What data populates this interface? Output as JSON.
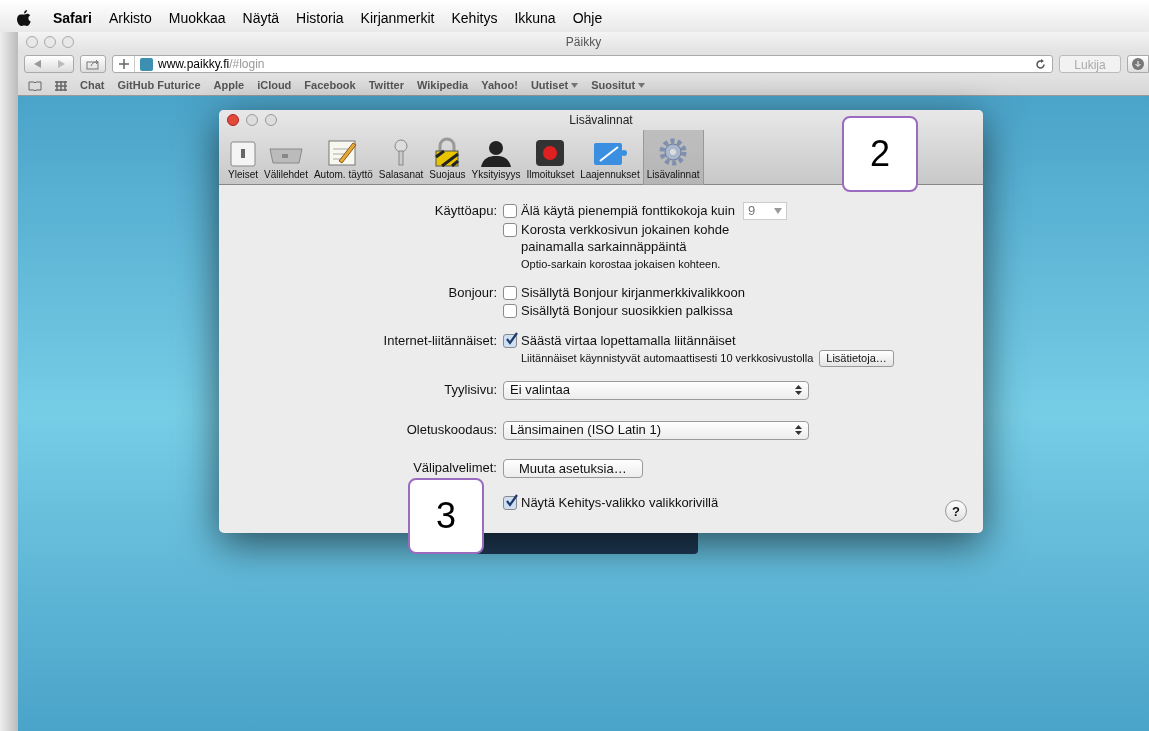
{
  "menu_bar": {
    "items": [
      {
        "label": "Safari",
        "kind": "app"
      },
      {
        "label": "Arkisto",
        "kind": "menu"
      },
      {
        "label": "Muokkaa",
        "kind": "menu"
      },
      {
        "label": "Näytä",
        "kind": "menu"
      },
      {
        "label": "Historia",
        "kind": "menu"
      },
      {
        "label": "Kirjanmerkit",
        "kind": "menu"
      },
      {
        "label": "Kehitys",
        "kind": "menu"
      },
      {
        "label": "Ikkuna",
        "kind": "menu"
      },
      {
        "label": "Ohje",
        "kind": "menu"
      }
    ]
  },
  "browser": {
    "title": "Päikky",
    "url_host": "www.paikky.fi",
    "url_path": "/#login",
    "reader": {
      "label": "Lukija",
      "disabled": true
    },
    "bookmarks": [
      {
        "label": "Chat",
        "has_menu": false
      },
      {
        "label": "GitHub Futurice",
        "has_menu": false
      },
      {
        "label": "Apple",
        "has_menu": false
      },
      {
        "label": "iCloud",
        "has_menu": false
      },
      {
        "label": "Facebook",
        "has_menu": false
      },
      {
        "label": "Twitter",
        "has_menu": false
      },
      {
        "label": "Wikipedia",
        "has_menu": false
      },
      {
        "label": "Yahoo!",
        "has_menu": false
      },
      {
        "label": "Uutiset",
        "has_menu": true
      },
      {
        "label": "Suositut",
        "has_menu": true
      }
    ]
  },
  "dialog": {
    "title": "Lisävalinnat",
    "tabs": [
      {
        "label": "Yleiset",
        "selected": false
      },
      {
        "label": "Välilehdet",
        "selected": false
      },
      {
        "label": "Autom. täyttö",
        "selected": false
      },
      {
        "label": "Salasanat",
        "selected": false
      },
      {
        "label": "Suojaus",
        "selected": false
      },
      {
        "label": "Yksityisyys",
        "selected": false
      },
      {
        "label": "Ilmoitukset",
        "selected": false
      },
      {
        "label": "Laajennukset",
        "selected": false
      },
      {
        "label": "Lisävalinnat",
        "selected": true
      }
    ],
    "rows": [
      {
        "label": "Käyttöapu:",
        "items": [
          {
            "kind": "checkbox",
            "label": "Älä käytä pienempiä fonttikokoja kuin",
            "checked": false,
            "select": {
              "value": "9",
              "disabled": true
            }
          },
          {
            "kind": "checkbox",
            "label": "Korosta verkkosivun jokainen kohde painamalla sarkainnäppäintä",
            "checked": false
          },
          {
            "kind": "note",
            "text": "Optio-sarkain korostaa jokaisen kohteen."
          }
        ]
      },
      {
        "label": "Bonjour:",
        "items": [
          {
            "kind": "checkbox",
            "label": "Sisällytä Bonjour kirjanmerkkivalikkoon",
            "checked": false
          },
          {
            "kind": "checkbox",
            "label": "Sisällytä Bonjour suosikkien palkissa",
            "checked": false
          }
        ]
      },
      {
        "label": "Internet-liitännäiset:",
        "items": [
          {
            "kind": "checkbox",
            "label": "Säästä virtaa lopettamalla liitännäiset",
            "checked": true
          },
          {
            "kind": "note",
            "text": "Liitännäiset käynnistyvät automaattisesti 10 verkkosivustolla",
            "button": "Lisätietoja…"
          }
        ]
      },
      {
        "label": "Tyylisivu:",
        "items": [
          {
            "kind": "popup",
            "value": "Ei valintaa"
          }
        ]
      },
      {
        "label": "Oletuskoodaus:",
        "items": [
          {
            "kind": "popup",
            "value": "Länsimainen (ISO Latin 1)"
          }
        ]
      },
      {
        "label": "Välipalvelimet:",
        "items": [
          {
            "kind": "button",
            "label": "Muuta asetuksia…"
          }
        ]
      },
      {
        "items": [
          {
            "kind": "checkbox",
            "label": "Näytä Kehitys-valikko valikkorivillä",
            "checked": true
          }
        ]
      }
    ],
    "help": "?"
  },
  "callouts": [
    "2",
    "3"
  ]
}
